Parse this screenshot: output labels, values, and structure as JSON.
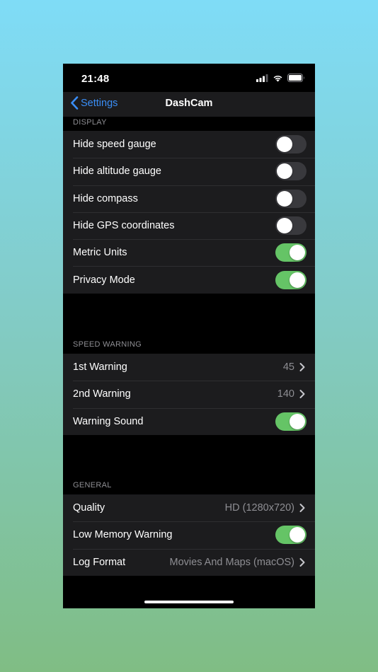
{
  "status_bar": {
    "time": "21:48",
    "signal_icon": "cellular-signal-icon",
    "wifi_icon": "wifi-icon",
    "battery_icon": "battery-icon"
  },
  "nav": {
    "back_label": "Settings",
    "back_icon": "chevron-left-icon",
    "title": "DashCam"
  },
  "colors": {
    "accent": "#3a8ef6",
    "toggle_on": "#65c466",
    "toggle_off": "#39393d",
    "cell_background": "#1c1c1e",
    "secondary_text": "#8e8e93"
  },
  "sections": {
    "display": {
      "header": "DISPLAY",
      "rows": [
        {
          "label": "Hide speed gauge",
          "toggle": false
        },
        {
          "label": "Hide altitude gauge",
          "toggle": false
        },
        {
          "label": "Hide compass",
          "toggle": false
        },
        {
          "label": "Hide GPS coordinates",
          "toggle": false
        },
        {
          "label": "Metric Units",
          "toggle": true
        },
        {
          "label": "Privacy Mode",
          "toggle": true
        }
      ]
    },
    "speed_warning": {
      "header": "SPEED WARNING",
      "rows": [
        {
          "label": "1st Warning",
          "value": "45"
        },
        {
          "label": "2nd Warning",
          "value": "140"
        },
        {
          "label": "Warning Sound",
          "toggle": true
        }
      ]
    },
    "general": {
      "header": "GENERAL",
      "rows": [
        {
          "label": "Quality",
          "value": "HD (1280x720)"
        },
        {
          "label": "Low Memory Warning",
          "toggle": true
        },
        {
          "label": "Log Format",
          "value": "Movies And Maps (macOS)"
        }
      ]
    }
  }
}
